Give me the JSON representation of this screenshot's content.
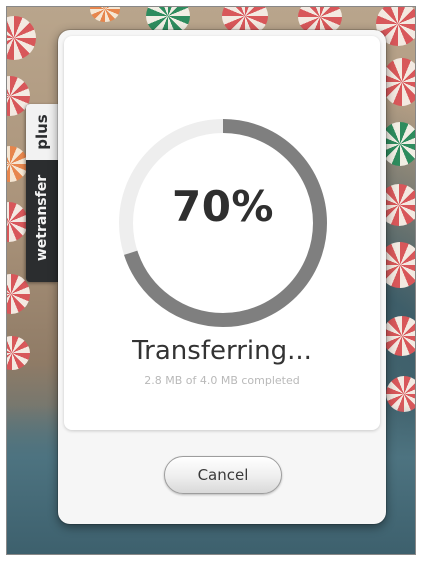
{
  "side_tab": {
    "brand": "wetransfer",
    "badge": "plus"
  },
  "transfer": {
    "progress_label": "70%",
    "progress_fraction": 0.7,
    "status": "Transferring...",
    "detail": "2.8 MB of 4.0 MB completed"
  },
  "actions": {
    "cancel_label": "Cancel"
  },
  "colors": {
    "ring_track": "#eeeeee",
    "ring_fill": "#7f7f7f",
    "panel": "#ffffff",
    "window": "#f6f6f6"
  },
  "icons": {
    "background": "beach-umbrellas-photo"
  }
}
